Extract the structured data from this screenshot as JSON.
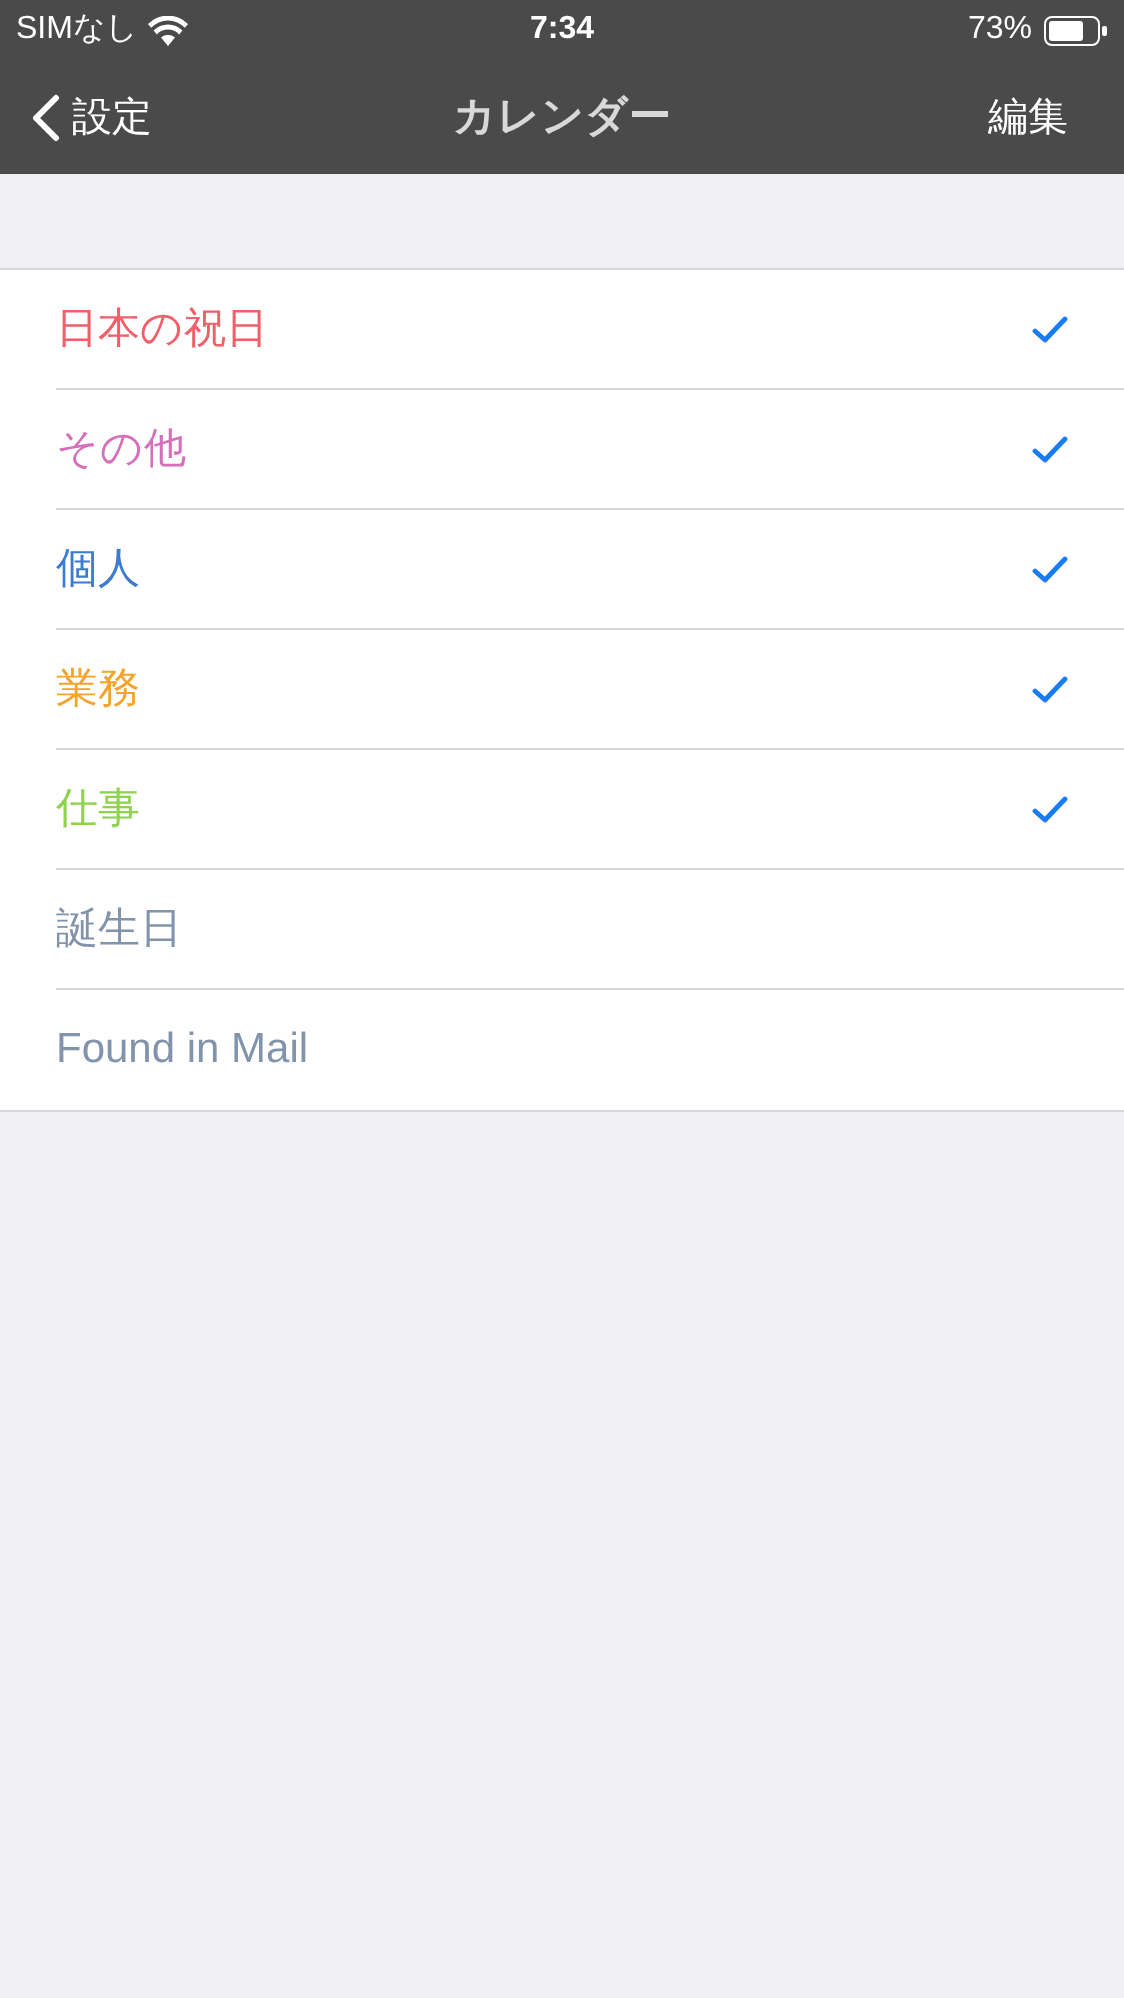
{
  "status_bar": {
    "carrier": "SIMなし",
    "time": "7:34",
    "battery": "73%"
  },
  "nav": {
    "back": "設定",
    "title": "カレンダー",
    "action": "編集"
  },
  "calendars": [
    {
      "name": "日本の祝日",
      "color": "#f0606a",
      "checked": true
    },
    {
      "name": "その他",
      "color": "#d66fba",
      "checked": true
    },
    {
      "name": "個人",
      "color": "#3b7bd0",
      "checked": true
    },
    {
      "name": "業務",
      "color": "#f5a32a",
      "checked": true
    },
    {
      "name": "仕事",
      "color": "#8fd24f",
      "checked": true
    },
    {
      "name": "誕生日",
      "color": "#8293ac",
      "checked": false
    },
    {
      "name": "Found in Mail",
      "color": "#8293ac",
      "checked": false
    }
  ]
}
